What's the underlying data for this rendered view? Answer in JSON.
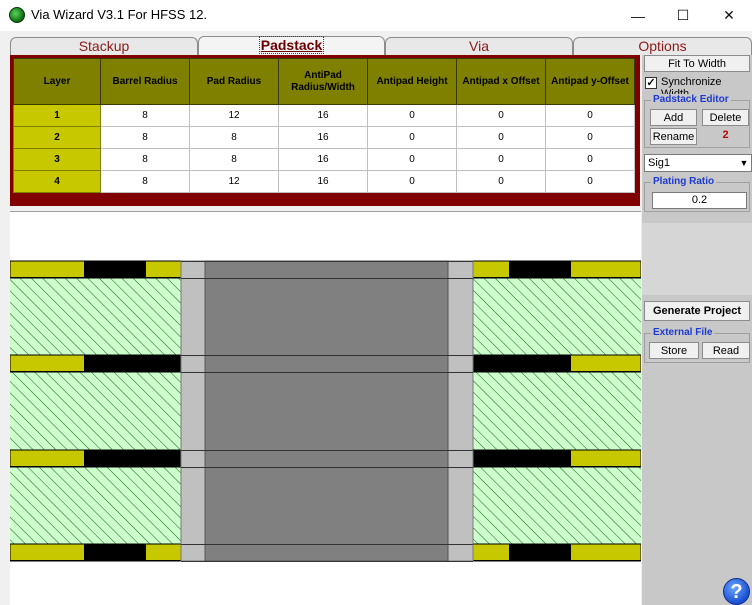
{
  "window": {
    "title": "Via Wizard V3.1 For HFSS 12.",
    "minimize": "—",
    "maximize": "☐",
    "close": "✕"
  },
  "tabs": [
    {
      "label": "Stackup",
      "active": false
    },
    {
      "label": "Padstack",
      "active": true
    },
    {
      "label": "Via",
      "active": false
    },
    {
      "label": "Options",
      "active": false
    }
  ],
  "table": {
    "headers": [
      "Layer",
      "Barrel Radius",
      "Pad Radius",
      "AntiPad Radius/Width",
      "Antipad Height",
      "Antipad x Offset",
      "Antipad y-Offset"
    ],
    "rows": [
      [
        "1",
        "8",
        "12",
        "16",
        "0",
        "0",
        "0"
      ],
      [
        "2",
        "8",
        "8",
        "16",
        "0",
        "0",
        "0"
      ],
      [
        "3",
        "8",
        "8",
        "16",
        "0",
        "0",
        "0"
      ],
      [
        "4",
        "8",
        "12",
        "16",
        "0",
        "0",
        "0"
      ]
    ]
  },
  "right_panel": {
    "fit_to_width": "Fit To Width",
    "synchronize_width": "Synchronize Width",
    "synchronize_checked": true,
    "padstack_editor": {
      "title": "Padstack Editor",
      "add": "Add",
      "delete": "Delete",
      "rename": "Rename",
      "count": "2"
    },
    "signal_select": "Sig1",
    "plating_ratio": {
      "title": "Plating Ratio",
      "value": "0.2"
    },
    "generate_project": "Generate Project",
    "external_file": {
      "title": "External File",
      "store": "Store",
      "read": "Read"
    },
    "help": "?"
  },
  "colors": {
    "table_border": "#800000",
    "header_bg": "#808000",
    "layer_cell": "#c8c800",
    "dielectric": "#ccffcc",
    "hatch": "#1a5a1a",
    "pad": "#c8c800",
    "antipad": "#000000",
    "barrel": "#808080",
    "plating": "#c0c0c0",
    "group_title": "#1c3ad4"
  }
}
